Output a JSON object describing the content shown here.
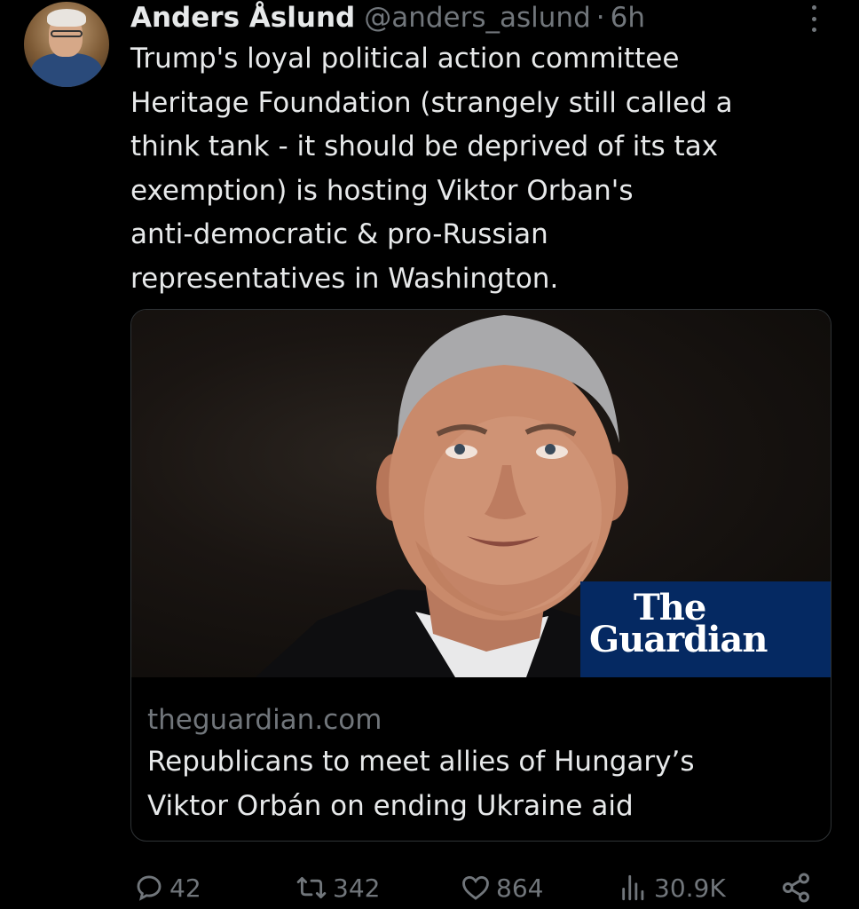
{
  "author": {
    "display_name": "Anders Åslund",
    "handle": "@anders_aslund",
    "separator": "·",
    "time": "6h"
  },
  "tweet": {
    "text": "Trump's loyal political action committee\nHeritage Foundation (strangely still called a\nthink tank - it should be deprived of its tax\nexemption) is hosting Viktor Orban's\nanti-democratic & pro-Russian\nrepresentatives in Washington."
  },
  "card": {
    "logo_line1": "The",
    "logo_line2": "Guardian",
    "domain": "theguardian.com",
    "title": "Republicans to meet allies of Hungary’s\nViktor Orbán on ending Ukraine aid"
  },
  "actions": {
    "replies": "42",
    "retweets": "342",
    "likes": "864",
    "views": "30.9K"
  },
  "colors": {
    "background": "#000000",
    "text": "#e7e9ea",
    "secondary": "#71767b",
    "guardian_blue": "#052962"
  },
  "icons": {
    "reply": "reply-bubble-icon",
    "retweet": "retweet-arrows-icon",
    "like": "heart-icon",
    "views": "bar-chart-icon",
    "share": "share-icon",
    "more": "more-vertical-icon"
  }
}
